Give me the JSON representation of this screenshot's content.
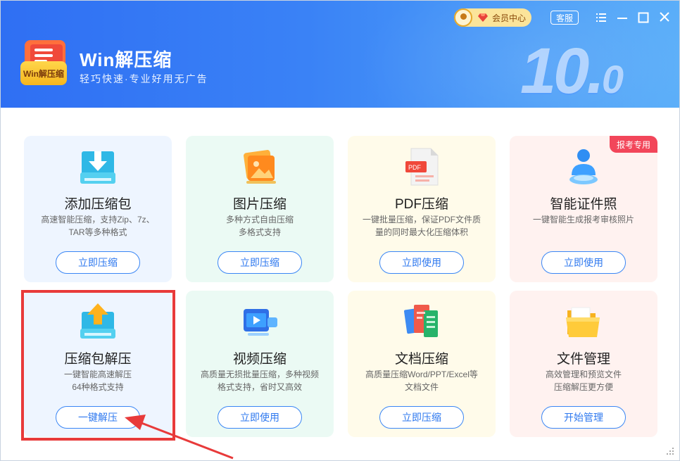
{
  "app": {
    "logo_text": "Win解压缩",
    "title": "Win解压缩",
    "subtitle": "轻巧快速·专业好用无广告",
    "version_main": "10.",
    "version_minor": "0"
  },
  "topbar": {
    "vip_label": "会员中心",
    "service_label": "客服"
  },
  "cards": [
    {
      "title": "添加压缩包",
      "desc1": "高速智能压缩，支持Zip、7z、",
      "desc2": "TAR等多种格式",
      "button": "立即压缩",
      "icon": "download-box-icon"
    },
    {
      "title": "图片压缩",
      "desc1": "多种方式自由压缩",
      "desc2": "多格式支持",
      "button": "立即压缩",
      "icon": "image-icon"
    },
    {
      "title": "PDF压缩",
      "desc1": "一键批量压缩，保证PDF文件质",
      "desc2": "量的同时最大化压缩体积",
      "button": "立即使用",
      "icon": "pdf-icon"
    },
    {
      "title": "智能证件照",
      "desc1": "一键智能生成报考审核照片",
      "desc2": "",
      "button": "立即使用",
      "icon": "person-icon",
      "tag": "报考专用"
    },
    {
      "title": "压缩包解压",
      "desc1": "一键智能高速解压",
      "desc2": "64种格式支持",
      "button": "一键解压",
      "icon": "upload-box-icon"
    },
    {
      "title": "视频压缩",
      "desc1": "高质量无损批量压缩，多种视频",
      "desc2": "格式支持，省时又高效",
      "button": "立即使用",
      "icon": "video-icon"
    },
    {
      "title": "文档压缩",
      "desc1": "高质量压缩Word/PPT/Excel等",
      "desc2": "文档文件",
      "button": "立即压缩",
      "icon": "documents-icon"
    },
    {
      "title": "文件管理",
      "desc1": "高效管理和预览文件",
      "desc2": "压缩解压更方便",
      "button": "开始管理",
      "icon": "folder-icon"
    }
  ],
  "colors": {
    "header_start": "#2f6ff3",
    "header_end": "#5aaef9",
    "accent": "#2f79ef",
    "highlight": "#e83a3a",
    "tag": "#f2465a"
  }
}
